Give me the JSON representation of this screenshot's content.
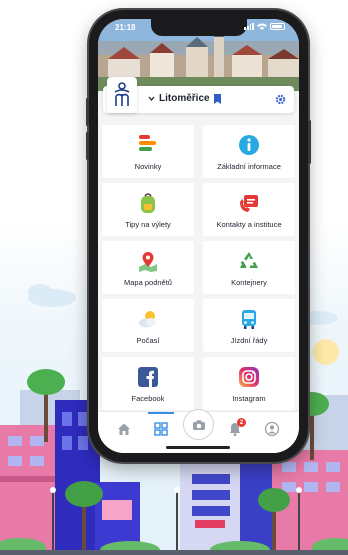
{
  "status_bar": {
    "time": "21:18"
  },
  "header": {
    "city": "Litoměřice"
  },
  "tiles": [
    {
      "label": "Novinky",
      "icon": "news-icon"
    },
    {
      "label": "Základní informace",
      "icon": "info-icon"
    },
    {
      "label": "Tipy na výlety",
      "icon": "backpack-icon"
    },
    {
      "label": "Kontakty a instituce",
      "icon": "contacts-icon"
    },
    {
      "label": "Mapa podnětů",
      "icon": "map-pin-icon"
    },
    {
      "label": "Kontejnery",
      "icon": "recycle-icon"
    },
    {
      "label": "Počasí",
      "icon": "weather-icon"
    },
    {
      "label": "Jízdní řády",
      "icon": "bus-icon"
    },
    {
      "label": "Facebook",
      "icon": "facebook-icon"
    },
    {
      "label": "Instagram",
      "icon": "instagram-icon"
    }
  ],
  "tabbar": {
    "items": [
      {
        "icon": "home-icon"
      },
      {
        "icon": "grid-icon",
        "active": true
      },
      {
        "icon": "camera-icon"
      },
      {
        "icon": "bell-icon",
        "badge": "2"
      },
      {
        "icon": "profile-icon"
      }
    ]
  },
  "colors": {
    "accent": "#3a8ee6",
    "brand": "#1f3c88",
    "badge": "#e53935"
  }
}
